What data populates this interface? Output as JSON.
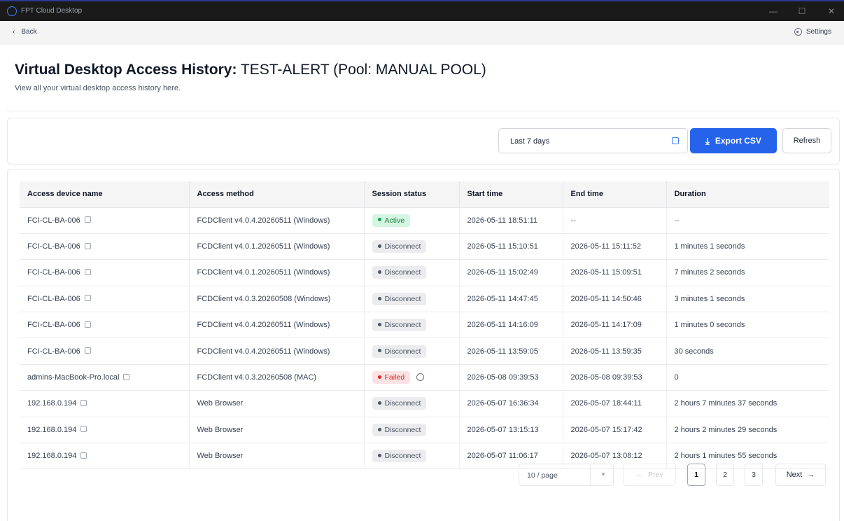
{
  "window": {
    "app_title": "FPT Cloud Desktop",
    "min_glyph": "—",
    "max_glyph": "☐",
    "close_glyph": "✕"
  },
  "nav": {
    "back_icon": "‹",
    "back_label": "Back",
    "settings_label": "Settings"
  },
  "header": {
    "title_prefix": "Virtual Desktop Access History:",
    "title_rest": " TEST-ALERT (Pool: MANUAL POOL)",
    "subtitle": "View all your virtual desktop access history here."
  },
  "filters": {
    "date_range": "Last 7 days",
    "export_icon": "⤓",
    "export_label": "Export CSV",
    "refresh_label": "Refresh"
  },
  "table": {
    "columns": [
      "Access device name",
      "Access method",
      "Session status",
      "Start time",
      "End time",
      "Duration"
    ],
    "rows": [
      {
        "device": "FCI-CL-BA-006",
        "method": "FCDClient v4.0.4.20260511 (Windows)",
        "status": "Active",
        "status_type": "active",
        "start": "2026-05-11 18:51:11",
        "end": "--",
        "duration": "--"
      },
      {
        "device": "FCI-CL-BA-006",
        "method": "FCDClient v4.0.1.20260511 (Windows)",
        "status": "Disconnect",
        "status_type": "disconnect",
        "start": "2026-05-11 15:10:51",
        "end": "2026-05-11 15:11:52",
        "duration": "1 minutes 1 seconds"
      },
      {
        "device": "FCI-CL-BA-006",
        "method": "FCDClient v4.0.1.20260511 (Windows)",
        "status": "Disconnect",
        "status_type": "disconnect",
        "start": "2026-05-11 15:02:49",
        "end": "2026-05-11 15:09:51",
        "duration": "7 minutes 2 seconds"
      },
      {
        "device": "FCI-CL-BA-006",
        "method": "FCDClient v4.0.3.20260508 (Windows)",
        "status": "Disconnect",
        "status_type": "disconnect",
        "start": "2026-05-11 14:47:45",
        "end": "2026-05-11 14:50:46",
        "duration": "3 minutes 1 seconds"
      },
      {
        "device": "FCI-CL-BA-006",
        "method": "FCDClient v4.0.4.20260511 (Windows)",
        "status": "Disconnect",
        "status_type": "disconnect",
        "start": "2026-05-11 14:16:09",
        "end": "2026-05-11 14:17:09",
        "duration": "1 minutes 0 seconds"
      },
      {
        "device": "FCI-CL-BA-006",
        "method": "FCDClient v4.0.4.20260511 (Windows)",
        "status": "Disconnect",
        "status_type": "disconnect",
        "start": "2026-05-11 13:59:05",
        "end": "2026-05-11 13:59:35",
        "duration": "30 seconds"
      },
      {
        "device": "admins-MacBook-Pro.local",
        "method": "FCDClient v4.0.3.20260508 (MAC)",
        "status": "Failed",
        "status_type": "failed",
        "start": "2026-05-08 09:39:53",
        "end": "2026-05-08 09:39:53",
        "duration": "0"
      },
      {
        "device": "192.168.0.194",
        "method": "Web Browser",
        "status": "Disconnect",
        "status_type": "disconnect",
        "start": "2026-05-07 16:36:34",
        "end": "2026-05-07 18:44:11",
        "duration": "2 hours 7 minutes 37 seconds"
      },
      {
        "device": "192.168.0.194",
        "method": "Web Browser",
        "status": "Disconnect",
        "status_type": "disconnect",
        "start": "2026-05-07 13:15:13",
        "end": "2026-05-07 15:17:42",
        "duration": "2 hours 2 minutes 29 seconds"
      },
      {
        "device": "192.168.0.194",
        "method": "Web Browser",
        "status": "Disconnect",
        "status_type": "disconnect",
        "start": "2026-05-07 11:06:17",
        "end": "2026-05-07 13:08:12",
        "duration": "2 hours 1 minutes 55 seconds"
      }
    ]
  },
  "pagination": {
    "page_size": "10 / page",
    "size_arrow": "▼",
    "prev_arrow": "←",
    "prev_label": "Prev",
    "pages": [
      "1",
      "2",
      "3"
    ],
    "current_page": "1",
    "next_label": "Next",
    "next_arrow": "→"
  }
}
